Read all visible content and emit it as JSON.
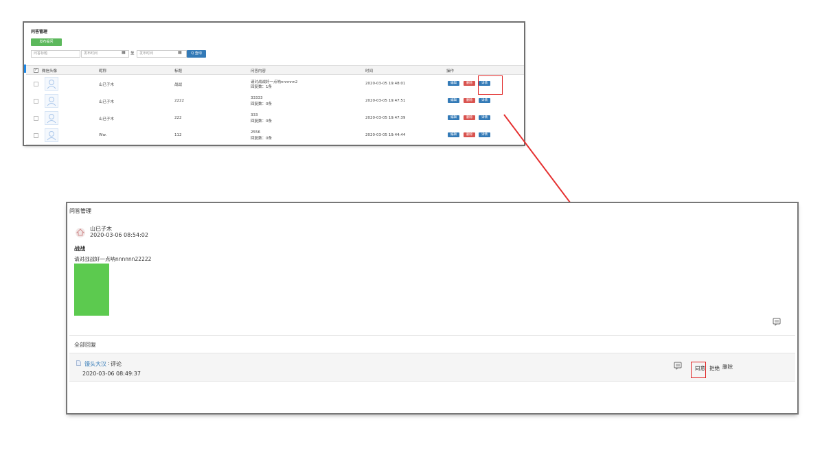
{
  "list_view": {
    "title": "问答管理",
    "publish_button": "发布提问",
    "filters": {
      "title_placeholder": "问答标题",
      "start_placeholder": "发布时间",
      "to_label": "至",
      "end_placeholder": "发布时间",
      "search_button": "Q 查询"
    },
    "columns": [
      "微信头像",
      "昵称",
      "标题",
      "问答内容",
      "时间",
      "操作"
    ],
    "rows": [
      {
        "nickname": "山已子木",
        "title": "战战",
        "content_line1": "请对战战好一点呐nnnnnn2",
        "content_line2": "回复数：1条",
        "time": "2020-03-05 19:48:01"
      },
      {
        "nickname": "山已子木",
        "title": "2222",
        "content_line1": "33333",
        "content_line2": "回复数：0条",
        "time": "2020-03-05 19:47:51"
      },
      {
        "nickname": "山已子木",
        "title": "222",
        "content_line1": "333",
        "content_line2": "回复数：0条",
        "time": "2020-03-05 19:47:39"
      },
      {
        "nickname": "Ww.",
        "title": "112",
        "content_line1": "2556",
        "content_line2": "回复数：0条",
        "time": "2020-03-05 19:44:44"
      }
    ],
    "actions": {
      "edit": "编辑",
      "delete": "删除",
      "detail": "详情"
    }
  },
  "detail_view": {
    "title": "问答管理",
    "author": "山已子木",
    "time": "2020-03-06 08:54:02",
    "question_title": "战战",
    "question_content": "请对战战好一点呐nnnnnn22222",
    "all_replies_label": "全部回复",
    "reply": {
      "author": "馒头大汉",
      "separator": ":",
      "text": "评论",
      "time": "2020-03-06 08:49:37",
      "approve": "同意",
      "reject": "拒绝",
      "delete": "删除"
    }
  },
  "colors": {
    "publish_green": "#5cb85c",
    "primary_blue": "#337ab7",
    "danger_red": "#d9534f",
    "highlight_red": "#e02020",
    "image_green": "#5cca4f"
  }
}
